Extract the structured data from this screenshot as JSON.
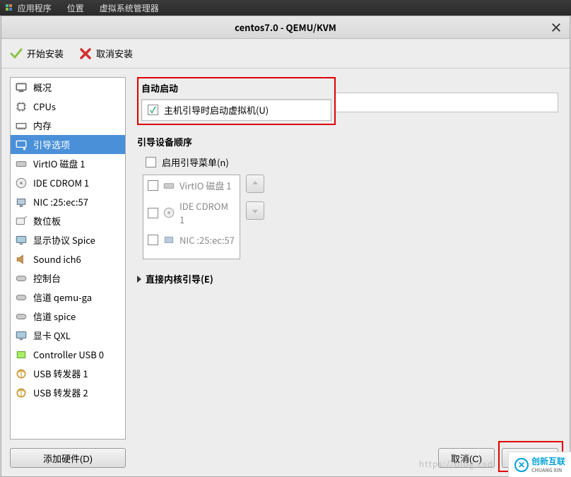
{
  "topbar": {
    "items": [
      "应用程序",
      "位置",
      "虚拟系统管理器"
    ]
  },
  "window": {
    "title": "centos7.0 - QEMU/KVM",
    "close": "×"
  },
  "toolbar": {
    "start_install": "开始安装",
    "cancel_install": "取消安装"
  },
  "sidebar": {
    "items": [
      {
        "icon": "overview",
        "label": "概况"
      },
      {
        "icon": "cpu",
        "label": "CPUs"
      },
      {
        "icon": "memory",
        "label": "内存"
      },
      {
        "icon": "boot",
        "label": "引导选项",
        "selected": true
      },
      {
        "icon": "disk",
        "label": "VirtIO 磁盘 1"
      },
      {
        "icon": "cdrom",
        "label": "IDE CDROM 1"
      },
      {
        "icon": "nic",
        "label": "NIC :25:ec:57"
      },
      {
        "icon": "tablet",
        "label": "数位板"
      },
      {
        "icon": "display",
        "label": "显示协议  Spice"
      },
      {
        "icon": "sound",
        "label": "Sound ich6"
      },
      {
        "icon": "console",
        "label": "控制台"
      },
      {
        "icon": "channel",
        "label": "信道  qemu-ga"
      },
      {
        "icon": "channel",
        "label": "信道  spice"
      },
      {
        "icon": "video",
        "label": "显卡  QXL"
      },
      {
        "icon": "usb-ctrl",
        "label": "Controller USB 0"
      },
      {
        "icon": "usb",
        "label": "USB 转发器 1"
      },
      {
        "icon": "usb",
        "label": "USB 转发器 2"
      }
    ],
    "add_hardware": "添加硬件(D)"
  },
  "main": {
    "autostart": {
      "title": "自动启动",
      "checkbox_label": "主机引导时启动虚拟机(U)",
      "checked": true
    },
    "boot_order": {
      "title": "引导设备顺序",
      "enable_menu": "启用引导菜单(n)",
      "devices": [
        {
          "icon": "disk",
          "label": "VirtIO 磁盘 1"
        },
        {
          "icon": "cdrom",
          "label": "IDE CDROM 1"
        },
        {
          "icon": "nic",
          "label": "NIC :25:ec:57"
        }
      ]
    },
    "direct_kernel": "直接内核引导(E)"
  },
  "footer": {
    "cancel": "取消(C)",
    "apply": ""
  },
  "watermark": {
    "text": "创新互联",
    "sub": "CHUANG XIN",
    "url": "https://blog.csd"
  }
}
